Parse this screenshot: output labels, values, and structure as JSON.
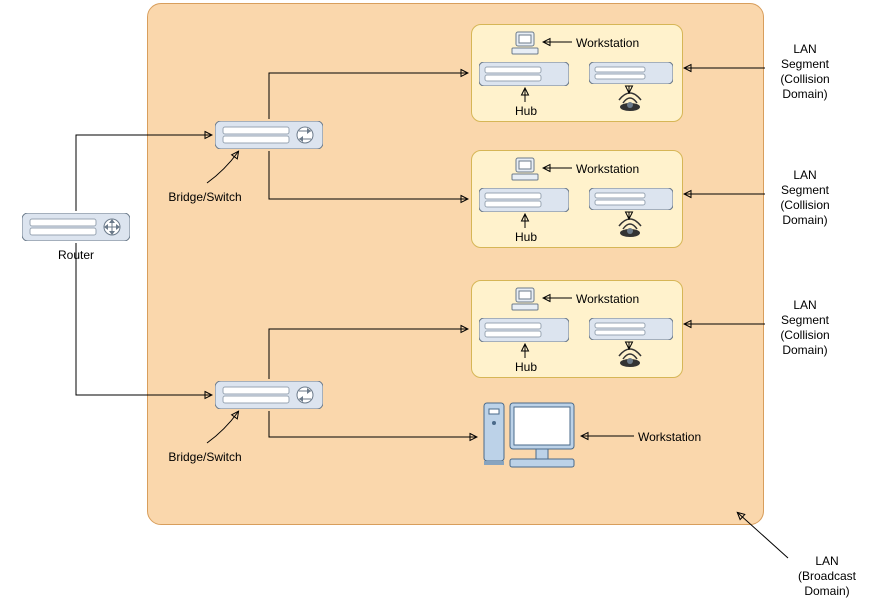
{
  "labels": {
    "router": "Router",
    "bridge_switch": "Bridge/Switch",
    "workstation": "Workstation",
    "hub": "Hub",
    "lan_segment": "LAN\nSegment\n(Collision\nDomain)",
    "lan_broadcast": "LAN\n(Broadcast\nDomain)"
  }
}
